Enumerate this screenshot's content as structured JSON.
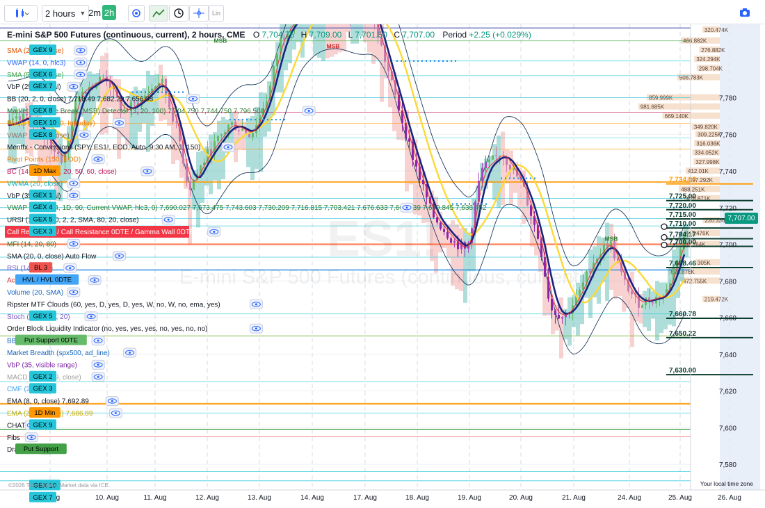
{
  "toolbar": {
    "interval": "2 hours",
    "quick_intervals": [
      "2m",
      "2h"
    ],
    "lin_label": "Lin"
  },
  "header": {
    "symbol_title": "E-mini S&P 500 Futures (continuous, current), 2 hours, CME",
    "o_label": "O",
    "o_value": "7,704.75",
    "h_label": "H",
    "h_value": "7,709.00",
    "l_label": "L",
    "l_value": "7,701.50",
    "c_label": "C",
    "c_value": "7,707.00",
    "change_label": "Period",
    "change_value": "+2.25 (+0.029%)"
  },
  "watermark": {
    "symbol": "ES1!",
    "name": "E-mini S&P 500 Futures (continuous, current)"
  },
  "indicators": [
    {
      "text": "SMA (20, 0, close)",
      "color": "#e65100"
    },
    {
      "text": "VWAP (14, 0, hlc3)",
      "color": "#2962ff"
    },
    {
      "text": "SMA (50, 0, close)",
      "color": "#43a047"
    },
    {
      "text": "VbP (25, manual)",
      "color": "#131722"
    },
    {
      "text": "BB (20, 2, 0, close)  7,718.49  7,682.29  7,656.08",
      "color": "#131722"
    },
    {
      "text": "Market Structure Break (MSB) Detector (3, 20, 100)  7,704.750  7,744.750  7,796.500",
      "color": "#2e7d32"
    },
    {
      "text": "Pivots Levels (150, Intraday)",
      "color": "#f57c00"
    },
    {
      "text": "VWAP (25, 0, close)",
      "color": "#8d6e63"
    },
    {
      "text": "Mentfx - Conversions (SPY, ES1!, EOD, Auto, 9:30 AM, 1, 150)",
      "color": "#131722"
    },
    {
      "text": "Pivot Points (150, EOD)",
      "color": "#f57c00"
    },
    {
      "text": "BC (14, 14, 3, 10, 20, 50, 60, close)",
      "color": "#c2185b"
    },
    {
      "text": "VWMA (20, close)",
      "color": "#00acc1"
    },
    {
      "text": "VbP (35, manual)",
      "color": "#131722"
    },
    {
      "text": "VWAP (1, 2, 3, 4, 1D, 90, Current VWAP, hlc3, 0)  7,690.027  7,673.475  7,743.603  7,730.209  7,716.815  7,703.421  7,676.633  7,663.239  7,649.845  7,636.452",
      "color": "#2e7d32"
    },
    {
      "text": "URSI (14, 21, 20, 2, 2, SMA, 80, 20, close)",
      "color": "#131722"
    },
    {
      "text": "Call Resistance / Call Resistance 0DTE / Gamma Wall 0DTE",
      "color": "#ffffff"
    },
    {
      "text": "MFI (14, 20, 80)",
      "color": "#2e7d32"
    },
    {
      "text": "SMA (20, 0, close)  Auto Flow",
      "color": "#131722"
    },
    {
      "text": "RSI (14, close)",
      "color": "#7e57c2"
    },
    {
      "text": "Acc/Distr Osc. (6, 10)",
      "color": "#d32f2f"
    },
    {
      "text": "Volume (20, SMA)",
      "color": "#1565c0"
    },
    {
      "text": "Ripster MTF Clouds (60, yes, D, yes, D, yes, W, no, W, no, ema, yes)",
      "color": "#131722"
    },
    {
      "text": "Stoch (14, 1, 80, 20)",
      "color": "#7e57c2"
    },
    {
      "text": "Order Block Liquidity Indicator (no, yes, yes, yes, no, yes, no, no)",
      "color": "#131722"
    },
    {
      "text": "BB (20, 2, 2, 0, close)",
      "color": "#1565c0"
    },
    {
      "text": "Market Breadth (spx500, ad_line)",
      "color": "#1565c0"
    },
    {
      "text": "VbP (35, visible range)",
      "color": "#7b1fa2"
    },
    {
      "text": "MACD (12, 26, 9, close)",
      "color": "#9e9e9e"
    },
    {
      "text": "CMF (20)",
      "color": "#42a5f5"
    },
    {
      "text": "EMA (8, 0, close)  7,692.89",
      "color": "#131722"
    },
    {
      "text": "EMA (21, 0, close)  7,686.89",
      "color": "#c6a700"
    },
    {
      "text": "CHAT",
      "color": "#131722"
    },
    {
      "text": "Fibs",
      "color": "#131722"
    },
    {
      "text": "Drawings",
      "color": "#131722"
    }
  ],
  "gex_tags": [
    {
      "label": "GEX 9",
      "row": 0,
      "color": "#26c6da"
    },
    {
      "label": "GEX 6",
      "row": 2,
      "color": "#26c6da"
    },
    {
      "label": "GEX 7",
      "row": 3,
      "color": "#26c6da"
    },
    {
      "label": "GEX 8",
      "row": 5,
      "color": "#26c6da"
    },
    {
      "label": "GEX 10",
      "row": 6,
      "color": "#26c6da"
    },
    {
      "label": "GEX 8",
      "row": 7,
      "color": "#26c6da"
    },
    {
      "label": "1D Max",
      "row": 10,
      "color": "#ff9800"
    },
    {
      "label": "GEX 1",
      "row": 12,
      "color": "#26c6da"
    },
    {
      "label": "GEX 4",
      "row": 13,
      "color": "#26c6da"
    },
    {
      "label": "GEX 5",
      "row": 14,
      "color": "#26c6da"
    },
    {
      "label": "GEX 3",
      "row": 15,
      "color": "#26c6da"
    },
    {
      "label": "BL 3",
      "row": 18,
      "color": "#ef5350"
    },
    {
      "label": "HVL / HVL 0DTE",
      "row": 19,
      "color": "#42a5f5"
    },
    {
      "label": "GEX 5",
      "row": 22,
      "color": "#26c6da"
    },
    {
      "label": "Put Support 0DTE",
      "row": 24,
      "color": "#66bb6a"
    },
    {
      "label": "GEX 2",
      "row": 27,
      "color": "#26c6da"
    },
    {
      "label": "GEX 3",
      "row": 28,
      "color": "#26c6da"
    },
    {
      "label": "1D Min",
      "row": 30,
      "color": "#ff9800"
    },
    {
      "label": "GEX 9",
      "row": 31,
      "color": "#26c6da"
    },
    {
      "label": "Put Support",
      "row": 33,
      "color": "#43a047"
    },
    {
      "label": "GEX 10",
      "row": 36,
      "color": "#26c6da"
    },
    {
      "label": "GEX 7",
      "row": 37,
      "color": "#26c6da"
    }
  ],
  "chart_data": {
    "type": "candlestick",
    "y_range": [
      7566,
      7820
    ],
    "y_ticks": [
      7580,
      7600,
      7620,
      7640,
      7660,
      7680,
      7700,
      7720,
      7740,
      7760,
      7780
    ],
    "x_labels": [
      "7. Aug",
      "10. Aug",
      "11. Aug",
      "12. Aug",
      "13. Aug",
      "14. Aug",
      "17. Aug",
      "18. Aug",
      "19. Aug",
      "20. Aug",
      "21. Aug",
      "24. Aug",
      "25. Aug",
      "26. Aug"
    ],
    "last_price": "7,707.00",
    "price_levels": [
      {
        "value": 7734.08,
        "label": "7,734.08",
        "color": "#ff9800"
      },
      {
        "value": 7725.0,
        "label": "7,725.00",
        "color": "#0b3d2e"
      },
      {
        "value": 7720.0,
        "label": "7,720.00",
        "color": "#0b3d2e"
      },
      {
        "value": 7715.0,
        "label": "7,715.00",
        "color": "#0b3d2e"
      },
      {
        "value": 7710.0,
        "label": "7,710.00",
        "color": "#0b3d2e"
      },
      {
        "value": 7704.17,
        "label": "7,704.17",
        "color": "#0b3d2e"
      },
      {
        "value": 7700.0,
        "label": "7,700.00",
        "color": "#0b3d2e"
      },
      {
        "value": 7688.46,
        "label": "7,688.46",
        "color": "#0b3d2e"
      },
      {
        "value": 7660.78,
        "label": "7,660.78",
        "color": "#0b3d2e"
      },
      {
        "value": 7650.22,
        "label": "7,650.22",
        "color": "#0b3d2e"
      },
      {
        "value": 7630.0,
        "label": "7,630.00",
        "color": "#0b3d2e"
      }
    ],
    "volume_profile": [
      {
        "price": 7817,
        "label": "320.474K",
        "width": 72
      },
      {
        "price": 7811,
        "label": "466.882K",
        "width": 160
      },
      {
        "price": 7806,
        "label": "276.882K",
        "width": 85
      },
      {
        "price": 7801,
        "label": "324.294K",
        "width": 105
      },
      {
        "price": 7796,
        "label": "298.704K",
        "width": 95
      },
      {
        "price": 7791,
        "label": "506.783K",
        "width": 175
      },
      {
        "price": 7780,
        "label": "859.999K",
        "width": 300
      },
      {
        "price": 7775,
        "label": "981.685K",
        "width": 335
      },
      {
        "price": 7770,
        "label": "669.140K",
        "width": 235
      },
      {
        "price": 7764,
        "label": "349.820K",
        "width": 115
      },
      {
        "price": 7760,
        "label": "309.225K",
        "width": 100
      },
      {
        "price": 7755,
        "label": "316.036K",
        "width": 105
      },
      {
        "price": 7750,
        "label": "334.052K",
        "width": 112
      },
      {
        "price": 7745,
        "label": "327.998K",
        "width": 108
      },
      {
        "price": 7740,
        "label": "412.01K",
        "width": 140
      },
      {
        "price": 7735,
        "label": "397.292K",
        "width": 135
      },
      {
        "price": 7730,
        "label": "488.251K",
        "width": 168
      },
      {
        "price": 7725,
        "label": "420.871K",
        "width": 145
      },
      {
        "price": 7713,
        "label": "220.336K",
        "width": 70
      },
      {
        "price": 7706,
        "label": "447.476K",
        "width": 150
      },
      {
        "price": 7700,
        "label": "482.764K",
        "width": 165
      },
      {
        "price": 7690,
        "label": "305K",
        "width": 100
      },
      {
        "price": 7685,
        "label": "620.876K",
        "width": 210
      },
      {
        "price": 7680,
        "label": "472.755K",
        "width": 160
      },
      {
        "price": 7670,
        "label": "219.472K",
        "width": 72
      }
    ],
    "msb_labels": [
      {
        "text": "MSB",
        "x": 317,
        "price": 7810,
        "color": "#2e7d32"
      },
      {
        "text": "MSB",
        "x": 479,
        "price": 7807,
        "color": "#c62828"
      },
      {
        "text": "MSB",
        "x": 879,
        "price": 7702,
        "color": "#2e7d32"
      }
    ],
    "copyright": "©2026 TrendSpider. Market data via ICE.",
    "timezone": "Your local time zone"
  }
}
